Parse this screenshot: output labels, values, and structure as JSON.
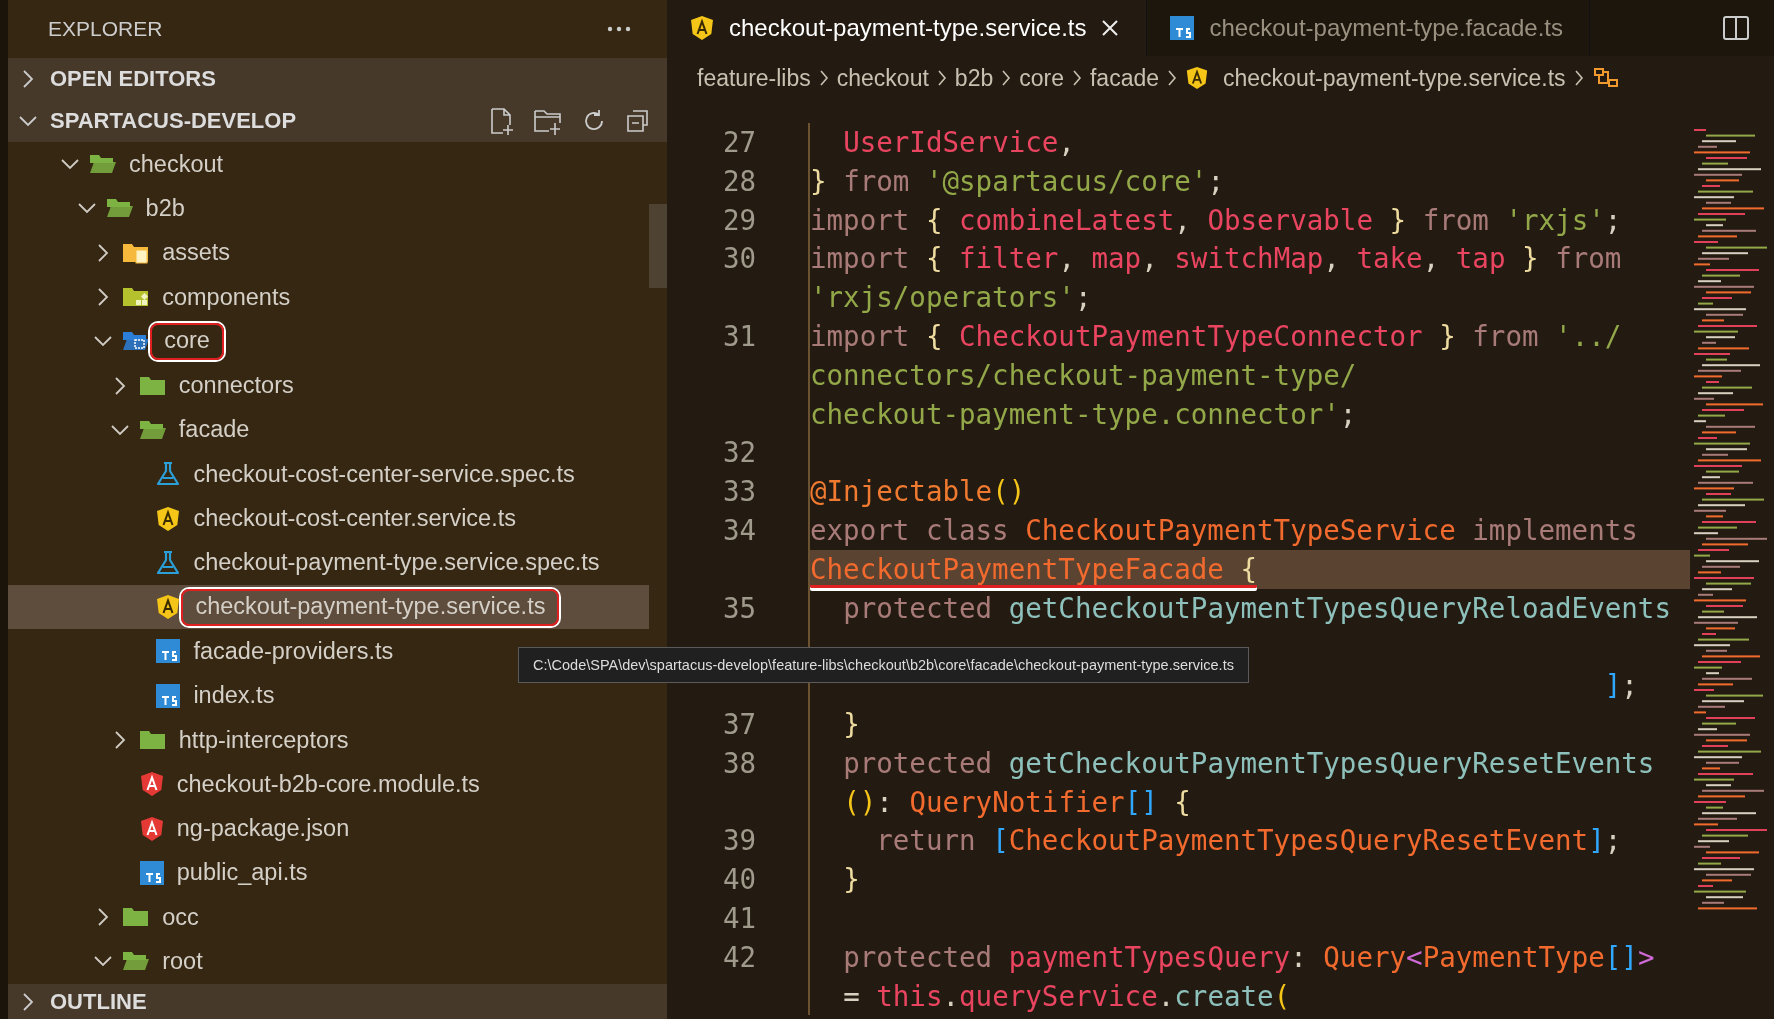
{
  "sidebar": {
    "title": "EXPLORER",
    "sections": [
      {
        "label": "OPEN EDITORS",
        "expanded": false
      },
      {
        "label": "SPARTACUS-DEVELOP",
        "expanded": true,
        "tree": [
          {
            "label": "checkout",
            "kind": "folder",
            "expanded": true,
            "selected": false,
            "annotated": false,
            "children": [
              {
                "label": "b2b",
                "kind": "folder",
                "expanded": true,
                "selected": false,
                "annotated": false,
                "children": [
                  {
                    "label": "assets",
                    "kind": "assets-folder",
                    "expanded": false,
                    "selected": false,
                    "annotated": false
                  },
                  {
                    "label": "components",
                    "kind": "components-folder",
                    "expanded": false,
                    "selected": false,
                    "annotated": false
                  },
                  {
                    "label": "core",
                    "kind": "core-folder",
                    "expanded": true,
                    "selected": false,
                    "annotated": true,
                    "children": [
                      {
                        "label": "connectors",
                        "kind": "folder",
                        "expanded": false,
                        "selected": false,
                        "annotated": false
                      },
                      {
                        "label": "facade",
                        "kind": "folder",
                        "expanded": true,
                        "selected": false,
                        "annotated": false,
                        "children": [
                          {
                            "label": "checkout-cost-center-service.spec.ts",
                            "kind": "spec-file",
                            "selected": false,
                            "annotated": false
                          },
                          {
                            "label": "checkout-cost-center.service.ts",
                            "kind": "service-file",
                            "selected": false,
                            "annotated": false
                          },
                          {
                            "label": "checkout-payment-type.service.spec.ts",
                            "kind": "spec-file",
                            "selected": false,
                            "annotated": false
                          },
                          {
                            "label": "checkout-payment-type.service.ts",
                            "kind": "service-file",
                            "selected": true,
                            "annotated": true
                          },
                          {
                            "label": "facade-providers.ts",
                            "kind": "ts-file",
                            "selected": false,
                            "annotated": false
                          },
                          {
                            "label": "index.ts",
                            "kind": "ts-file",
                            "selected": false,
                            "annotated": false
                          }
                        ]
                      },
                      {
                        "label": "http-interceptors",
                        "kind": "folder",
                        "expanded": false,
                        "selected": false,
                        "annotated": false
                      },
                      {
                        "label": "checkout-b2b-core.module.ts",
                        "kind": "module-file",
                        "selected": false,
                        "annotated": false
                      },
                      {
                        "label": "ng-package.json",
                        "kind": "module-file",
                        "selected": false,
                        "annotated": false
                      },
                      {
                        "label": "public_api.ts",
                        "kind": "ts-file",
                        "selected": false,
                        "annotated": false
                      }
                    ]
                  },
                  {
                    "label": "occ",
                    "kind": "folder",
                    "expanded": false,
                    "selected": false,
                    "annotated": false
                  },
                  {
                    "label": "root",
                    "kind": "folder",
                    "expanded": true,
                    "selected": false,
                    "annotated": false
                  }
                ]
              }
            ]
          }
        ]
      },
      {
        "label": "OUTLINE",
        "expanded": false
      }
    ]
  },
  "editor": {
    "tabs": [
      {
        "label": "checkout-payment-type.service.ts",
        "kind": "service-file",
        "selected": true
      },
      {
        "label": "checkout-payment-type.facade.ts",
        "kind": "ts-file",
        "selected": false
      }
    ],
    "breadcrumbs": [
      {
        "label": "feature-libs",
        "kind": "folder"
      },
      {
        "label": "checkout",
        "kind": "folder"
      },
      {
        "label": "b2b",
        "kind": "folder"
      },
      {
        "label": "core",
        "kind": "folder"
      },
      {
        "label": "facade",
        "kind": "folder"
      },
      {
        "label": "checkout-payment-type.service.ts",
        "kind": "service-file"
      }
    ],
    "lines": [
      {
        "number": "27",
        "rows": [
          {
            "current": false,
            "annotated": false,
            "tokens": [
              {
                "kind": "var",
                "text": "  UserIdService"
              },
              {
                "kind": "punct",
                "text": ","
              }
            ]
          }
        ]
      },
      {
        "number": "28",
        "rows": [
          {
            "current": false,
            "annotated": false,
            "tokens": [
              {
                "kind": "brace",
                "text": "} "
              },
              {
                "kind": "kw",
                "text": "from "
              },
              {
                "kind": "str",
                "text": "'@spartacus/core'"
              },
              {
                "kind": "punct",
                "text": ";"
              }
            ]
          }
        ]
      },
      {
        "number": "29",
        "rows": [
          {
            "current": false,
            "annotated": false,
            "tokens": [
              {
                "kind": "kw",
                "text": "import "
              },
              {
                "kind": "brace",
                "text": "{ "
              },
              {
                "kind": "var",
                "text": "combineLatest"
              },
              {
                "kind": "punct",
                "text": ", "
              },
              {
                "kind": "var",
                "text": "Observable "
              },
              {
                "kind": "brace",
                "text": "} "
              },
              {
                "kind": "kw",
                "text": "from "
              },
              {
                "kind": "str",
                "text": "'rxjs'"
              },
              {
                "kind": "punct",
                "text": ";"
              }
            ]
          }
        ]
      },
      {
        "number": "30",
        "rows": [
          {
            "current": false,
            "annotated": false,
            "tokens": [
              {
                "kind": "kw",
                "text": "import "
              },
              {
                "kind": "brace",
                "text": "{ "
              },
              {
                "kind": "var",
                "text": "filter"
              },
              {
                "kind": "punct",
                "text": ", "
              },
              {
                "kind": "var",
                "text": "map"
              },
              {
                "kind": "punct",
                "text": ", "
              },
              {
                "kind": "var",
                "text": "switchMap"
              },
              {
                "kind": "punct",
                "text": ", "
              },
              {
                "kind": "var",
                "text": "take"
              },
              {
                "kind": "punct",
                "text": ", "
              },
              {
                "kind": "var",
                "text": "tap "
              },
              {
                "kind": "brace",
                "text": "} "
              },
              {
                "kind": "kw",
                "text": "from"
              }
            ]
          },
          {
            "current": false,
            "annotated": false,
            "tokens": [
              {
                "kind": "str",
                "text": "'rxjs/operators'"
              },
              {
                "kind": "punct",
                "text": ";"
              }
            ]
          }
        ]
      },
      {
        "number": "31",
        "rows": [
          {
            "current": false,
            "annotated": false,
            "tokens": [
              {
                "kind": "kw",
                "text": "import "
              },
              {
                "kind": "brace",
                "text": "{ "
              },
              {
                "kind": "var",
                "text": "CheckoutPaymentTypeConnector "
              },
              {
                "kind": "brace",
                "text": "} "
              },
              {
                "kind": "kw",
                "text": "from "
              },
              {
                "kind": "str",
                "text": "'../"
              }
            ]
          },
          {
            "current": false,
            "annotated": false,
            "tokens": [
              {
                "kind": "str",
                "text": "connectors/checkout-payment-type/"
              }
            ]
          },
          {
            "current": false,
            "annotated": false,
            "tokens": [
              {
                "kind": "str",
                "text": "checkout-payment-type.connector'"
              },
              {
                "kind": "punct",
                "text": ";"
              }
            ]
          }
        ]
      },
      {
        "number": "32",
        "rows": [
          {
            "current": false,
            "annotated": false,
            "tokens": []
          }
        ]
      },
      {
        "number": "33",
        "rows": [
          {
            "current": false,
            "annotated": false,
            "tokens": [
              {
                "kind": "deco",
                "text": "@Injectable"
              },
              {
                "kind": "paren",
                "text": "()"
              }
            ]
          }
        ]
      },
      {
        "number": "34",
        "rows": [
          {
            "current": false,
            "annotated": false,
            "tokens": [
              {
                "kind": "kw",
                "text": "export class "
              },
              {
                "kind": "cls",
                "text": "CheckoutPaymentTypeService "
              },
              {
                "kind": "kw",
                "text": "implements"
              }
            ]
          },
          {
            "current": true,
            "annotated": true,
            "tokens": [
              {
                "kind": "cls",
                "text": "CheckoutPaymentTypeFacade "
              },
              {
                "kind": "brace",
                "text": "{"
              }
            ]
          }
        ]
      },
      {
        "number": "35",
        "rows": [
          {
            "current": false,
            "annotated": false,
            "tokens": [
              {
                "kind": "kw",
                "text": "  protected "
              },
              {
                "kind": "fn",
                "text": "getCheckoutPaymentTypesQueryReloadEvents"
              }
            ]
          },
          {
            "current": false,
            "annotated": false,
            "tokens": []
          }
        ]
      },
      {
        "rows": [
          {
            "current": false,
            "annotated": false,
            "tokens": [
              {
                "kind": "blue",
                "text": "                                                ]"
              },
              {
                "kind": "punct",
                "text": ";"
              }
            ]
          }
        ]
      },
      {
        "number": "37",
        "rows": [
          {
            "current": false,
            "annotated": false,
            "tokens": [
              {
                "kind": "brace",
                "text": "  }"
              }
            ]
          }
        ]
      },
      {
        "number": "38",
        "rows": [
          {
            "current": false,
            "annotated": false,
            "tokens": [
              {
                "kind": "kw",
                "text": "  protected "
              },
              {
                "kind": "fn",
                "text": "getCheckoutPaymentTypesQueryResetEvents"
              }
            ]
          },
          {
            "current": false,
            "annotated": false,
            "tokens": [
              {
                "kind": "paren",
                "text": "  ()"
              },
              {
                "kind": "punct",
                "text": ": "
              },
              {
                "kind": "cls",
                "text": "QueryNotifier"
              },
              {
                "kind": "blue",
                "text": "[] "
              },
              {
                "kind": "brace",
                "text": "{"
              }
            ]
          }
        ]
      },
      {
        "number": "39",
        "rows": [
          {
            "current": false,
            "annotated": false,
            "tokens": [
              {
                "kind": "kw",
                "text": "    return "
              },
              {
                "kind": "blue",
                "text": "["
              },
              {
                "kind": "cls",
                "text": "CheckoutPaymentTypesQueryResetEvent"
              },
              {
                "kind": "blue",
                "text": "]"
              },
              {
                "kind": "punct",
                "text": ";"
              }
            ]
          }
        ]
      },
      {
        "number": "40",
        "rows": [
          {
            "current": false,
            "annotated": false,
            "tokens": [
              {
                "kind": "brace",
                "text": "  }"
              }
            ]
          }
        ]
      },
      {
        "number": "41",
        "rows": [
          {
            "current": false,
            "annotated": false,
            "tokens": []
          }
        ]
      },
      {
        "number": "42",
        "rows": [
          {
            "current": false,
            "annotated": false,
            "tokens": [
              {
                "kind": "kw",
                "text": "  protected "
              },
              {
                "kind": "var",
                "text": "paymentTypesQuery"
              },
              {
                "kind": "punct",
                "text": ": "
              },
              {
                "kind": "cls",
                "text": "Query"
              },
              {
                "kind": "pink",
                "text": "<"
              },
              {
                "kind": "cls",
                "text": "PaymentType"
              },
              {
                "kind": "blue",
                "text": "[]"
              },
              {
                "kind": "pink",
                "text": ">"
              }
            ]
          },
          {
            "current": false,
            "annotated": false,
            "tokens": [
              {
                "kind": "punct",
                "text": "  = "
              },
              {
                "kind": "var",
                "text": "this"
              },
              {
                "kind": "punct",
                "text": "."
              },
              {
                "kind": "var",
                "text": "queryService"
              },
              {
                "kind": "punct",
                "text": "."
              },
              {
                "kind": "fn",
                "text": "create"
              },
              {
                "kind": "paren",
                "text": "("
              }
            ]
          }
        ]
      }
    ]
  },
  "tooltip": {
    "text": "C:\\Code\\SPA\\dev\\spartacus-develop\\feature-libs\\checkout\\b2b\\core\\facade\\checkout-payment-type.service.ts"
  }
}
